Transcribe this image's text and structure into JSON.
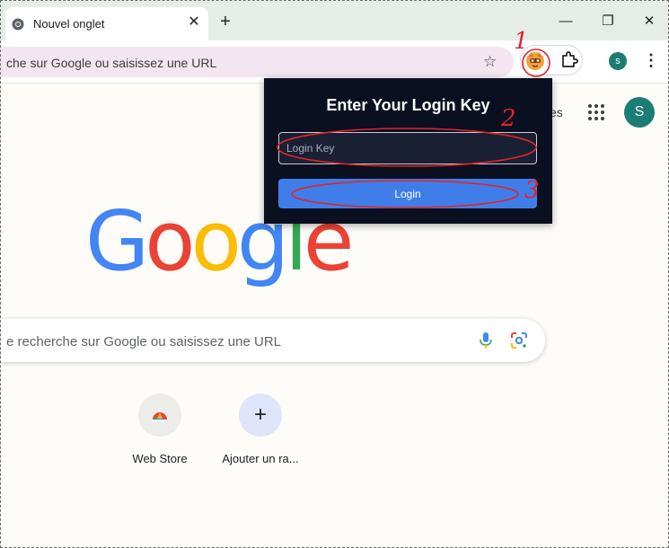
{
  "colors": {
    "tabstrip_bg": "#e6ece6",
    "omnibox_bg": "#f4e6f0",
    "popup_bg": "#0b1020",
    "login_button": "#3f7ee8",
    "avatar": "#1b7d74",
    "annotation": "#e0242b",
    "google_blue": "#4285f4",
    "google_red": "#ea4335",
    "google_yellow": "#fbbc05",
    "google_green": "#34a853"
  },
  "tab": {
    "title": "Nouvel onglet",
    "favicon": "chrome-icon",
    "close_glyph": "✕"
  },
  "window": {
    "new_tab_glyph": "+",
    "minimize_glyph": "—",
    "restore_glyph": "❐",
    "close_glyph": "✕"
  },
  "toolbar": {
    "omnibox_text": "che sur Google ou saisissez une URL",
    "star_glyph": "☆",
    "profile_initial": "s",
    "menu_glyph": "⋮"
  },
  "page": {
    "partial_link_text": "es",
    "avatar_initial": "S",
    "logo_letters": [
      "G",
      "o",
      "o",
      "g",
      "l",
      "e"
    ],
    "search_placeholder": "e recherche sur Google ou saisissez une URL"
  },
  "shortcuts": [
    {
      "label": "Web Store",
      "icon": "chrome-web-store-icon"
    },
    {
      "label": "Ajouter un ra...",
      "icon": "plus-icon",
      "glyph": "+"
    }
  ],
  "popup": {
    "title": "Enter Your Login Key",
    "input_placeholder": "Login Key",
    "button_label": "Login"
  },
  "annotations": [
    {
      "label": "1"
    },
    {
      "label": "2"
    },
    {
      "label": "3"
    }
  ]
}
